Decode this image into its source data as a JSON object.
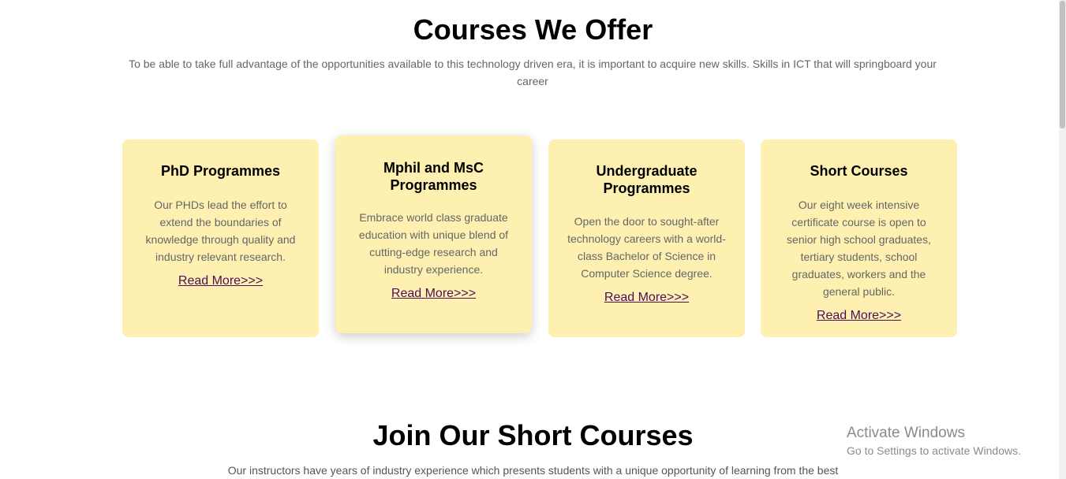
{
  "courses_section": {
    "title": "Courses We Offer",
    "intro": "To be able to take full advantage of the opportunities available to this technology driven era, it is important to acquire new skills. Skills in ICT that will springboard your career"
  },
  "cards": [
    {
      "title": "PhD Programmes",
      "description": "Our PHDs lead the effort to extend the boundaries of knowledge through quality and industry relevant research.",
      "link": "Read More>>>"
    },
    {
      "title": "Mphil and MsC Programmes",
      "description": "Embrace world class graduate education with unique blend of cutting-edge research and industry experience.",
      "link": "Read More>>>"
    },
    {
      "title": "Undergraduate Programmes",
      "description": "Open the door to sought-after technology careers with a world-class Bachelor of Science in Computer Science degree.",
      "link": "Read More>>>"
    },
    {
      "title": "Short Courses",
      "description": "Our eight week intensive certificate course is open to senior high school graduates, tertiary students, school graduates, workers and the general public.",
      "link": "Read More>>>"
    }
  ],
  "short_courses_section": {
    "title": "Join Our Short Courses",
    "intro": "Our instructors have years of industry experience which presents students with a unique opportunity of learning from the best"
  },
  "watermark": {
    "line1": "Activate Windows",
    "line2": "Go to Settings to activate Windows."
  },
  "colors": {
    "card_background": "#fef0b1",
    "link": "#4b0f5a",
    "body_text": "#666666"
  }
}
